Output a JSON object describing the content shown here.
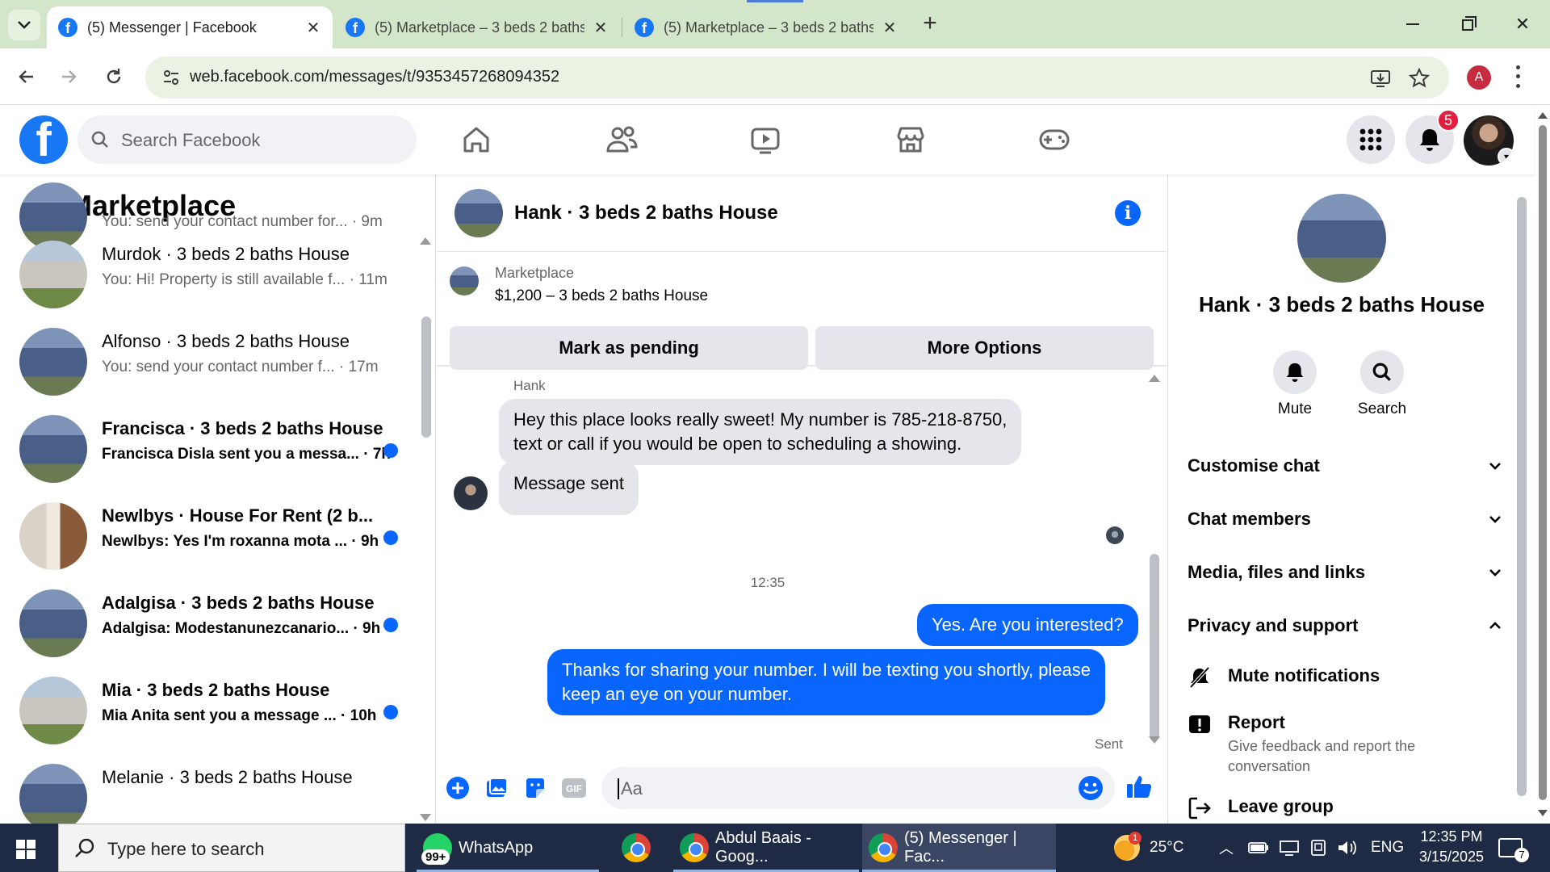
{
  "browser": {
    "tabs": [
      {
        "title": "(5) Messenger | Facebook",
        "active": true
      },
      {
        "title": "(5) Marketplace – 3 beds 2 baths",
        "active": false
      },
      {
        "title": "(5) Marketplace – 3 beds 2 baths",
        "active": false
      }
    ],
    "url": "web.facebook.com/messages/t/9353457268094352",
    "profile_initial": "A"
  },
  "fb": {
    "search_placeholder": "Search Facebook",
    "notification_count": "5"
  },
  "left": {
    "title": "Marketplace",
    "chats": [
      {
        "name": "",
        "preview": "You: send your contact number for...",
        "time": "· 9m",
        "unread": false,
        "pic": "house-blue"
      },
      {
        "name": "Murdok · 3 beds 2 baths House",
        "preview": "You: Hi! Property is still available f...",
        "time": "· 11m",
        "unread": false,
        "pic": "house-white"
      },
      {
        "name": "Alfonso · 3 beds 2 baths House",
        "preview": "You: send your contact number f...",
        "time": "· 17m",
        "unread": false,
        "pic": "house-blue"
      },
      {
        "name": "Francisca · 3 beds 2 baths House",
        "preview": "Francisca Disla sent you a messa...",
        "time": "· 7h",
        "unread": true,
        "pic": "house-blue"
      },
      {
        "name": "Newlbys · House For Rent (2 b...",
        "preview": "Newlbys: Yes I'm roxanna mota ...",
        "time": "· 9h",
        "unread": true,
        "pic": "room"
      },
      {
        "name": "Adalgisa · 3 beds 2 baths House",
        "preview": "Adalgisa: Modestanunezcanario...",
        "time": "· 9h",
        "unread": true,
        "pic": "house-blue"
      },
      {
        "name": "Mia · 3 beds 2 baths House",
        "preview": "Mia Anita sent you a message ...",
        "time": "· 10h",
        "unread": true,
        "pic": "house-white"
      },
      {
        "name": "Melanie · 3 beds 2 baths House",
        "preview": "",
        "time": "",
        "unread": false,
        "pic": "house-blue"
      }
    ]
  },
  "conversation": {
    "title": "Hank · 3 beds 2 baths House",
    "listing_category": "Marketplace",
    "listing_title": "$1,200 – 3 beds 2 baths House",
    "mark_pending_label": "Mark as pending",
    "more_options_label": "More Options",
    "sender_name": "Hank",
    "incoming_1_line1": "Hey this place looks really sweet! My number is 785-218-8750,",
    "incoming_1_line2": "text or call if you would be open to scheduling a showing.",
    "incoming_2": "Message sent",
    "timestamp": "12:35",
    "outgoing_1": "Yes. Are you interested?",
    "outgoing_2_line1": "Thanks for sharing your number. I will be texting you shortly, please",
    "outgoing_2_line2": "keep an eye on your number.",
    "status": "Sent",
    "composer_placeholder": "Aa"
  },
  "info_panel": {
    "name": "Hank · 3 beds 2 baths House",
    "mute_label": "Mute",
    "search_label": "Search",
    "sections": [
      "Customise chat",
      "Chat members",
      "Media, files and links",
      "Privacy and support"
    ],
    "mute_notifications": "Mute notifications",
    "report_title": "Report",
    "report_desc": "Give feedback and report the conversation",
    "leave_group": "Leave group"
  },
  "taskbar": {
    "search_placeholder": "Type here to search",
    "apps": [
      {
        "label": "WhatsApp",
        "badge": "99+"
      },
      {
        "label": ""
      },
      {
        "label": "Abdul Baais - Goog..."
      },
      {
        "label": "(5) Messenger | Fac..."
      }
    ],
    "weather": "25°C",
    "weather_badge": "1",
    "language": "ENG",
    "time": "12:35 PM",
    "date": "3/15/2025",
    "notifications": "7"
  },
  "colors": {
    "fb_blue": "#1877f2",
    "messenger_blue": "#0866ff",
    "unread_dot": "#0866ff",
    "notification_red": "#e41e3f",
    "chrome_tabstrip": "#d3e6c9"
  }
}
